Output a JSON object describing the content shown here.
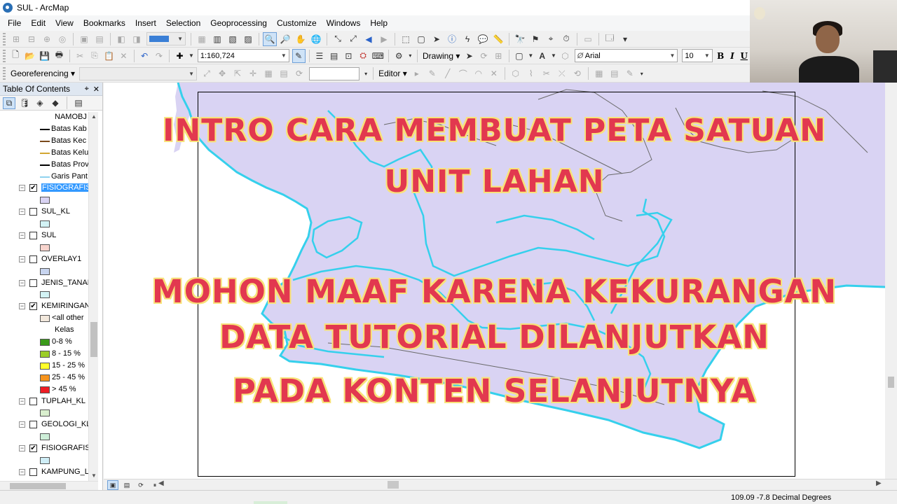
{
  "window": {
    "title": "SUL - ArcMap"
  },
  "menu": [
    "File",
    "Edit",
    "View",
    "Bookmarks",
    "Insert",
    "Selection",
    "Geoprocessing",
    "Customize",
    "Windows",
    "Help"
  ],
  "toolbar": {
    "map_scale": "1:160,724",
    "drawing_label": "Drawing",
    "font_name": "Arial",
    "font_size": "10",
    "bold_label": "B",
    "italic_label": "I",
    "underline_label": "U",
    "georeferencing_label": "Georeferencing",
    "editor_label": "Editor"
  },
  "toc": {
    "title": "Table Of Contents",
    "pin": "⌖",
    "close": "✕",
    "items": [
      {
        "type": "label",
        "label": "NAMOBJ",
        "indent": 78
      },
      {
        "type": "line",
        "label": "Batas Kab",
        "color": "#000000"
      },
      {
        "type": "line",
        "label": "Batas Kec",
        "color": "#7a4a1c"
      },
      {
        "type": "line",
        "label": "Batas Kelu",
        "color": "#d2a733"
      },
      {
        "type": "line",
        "label": "Batas Prov",
        "color": "#000000"
      },
      {
        "type": "line",
        "label": "Garis Pant",
        "color": "#8fd2ef"
      },
      {
        "type": "layer",
        "label": "FISIOGRAFIS",
        "checked": true,
        "selected": true
      },
      {
        "type": "swatch",
        "color": "#d9d3f3"
      },
      {
        "type": "layer",
        "label": "SUL_KL",
        "checked": false
      },
      {
        "type": "swatch",
        "color": "#d3f3f5"
      },
      {
        "type": "layer",
        "label": "SUL",
        "checked": false
      },
      {
        "type": "swatch",
        "color": "#f8d4cd"
      },
      {
        "type": "layer",
        "label": "OVERLAY1",
        "checked": false
      },
      {
        "type": "swatch",
        "color": "#c7d4ef"
      },
      {
        "type": "layer",
        "label": "JENIS_TANAH",
        "checked": false
      },
      {
        "type": "swatch",
        "color": "#d3f3f5"
      },
      {
        "type": "layer",
        "label": "KEMIRINGAN",
        "checked": true
      },
      {
        "type": "swatchlabel",
        "label": "<all other",
        "color": "#f2e8dc"
      },
      {
        "type": "label",
        "label": "Kelas",
        "indent": 78
      },
      {
        "type": "swatchlabel",
        "label": "0-8 %",
        "color": "#3a9a1a"
      },
      {
        "type": "swatchlabel",
        "label": "8 - 15 %",
        "color": "#9ccd28"
      },
      {
        "type": "swatchlabel",
        "label": "15 - 25 %",
        "color": "#ffff2a"
      },
      {
        "type": "swatchlabel",
        "label": "25 - 45 %",
        "color": "#f7941d"
      },
      {
        "type": "swatchlabel",
        "label": "> 45 %",
        "color": "#ee1c24"
      },
      {
        "type": "layer",
        "label": "TUPLAH_KL",
        "checked": false
      },
      {
        "type": "swatch",
        "color": "#d9efce"
      },
      {
        "type": "layer",
        "label": "GEOLOGI_KL",
        "checked": false
      },
      {
        "type": "swatch",
        "color": "#cdeed8"
      },
      {
        "type": "layer",
        "label": "FISIOGRAFIS_",
        "checked": true
      },
      {
        "type": "swatch",
        "color": "#cfeef7"
      },
      {
        "type": "layer",
        "label": "KAMPUNG_L",
        "checked": false
      }
    ]
  },
  "overlay": {
    "title_line1": "INTRO CARA MEMBUAT PETA SATUAN",
    "title_line2": "UNIT LAHAN",
    "message_line1": "MOHON MAAF KARENA KEKURANGAN",
    "message_line2": "DATA TUTORIAL DILANJUTKAN",
    "message_line3": "PADA KONTEN SELANJUTNYA"
  },
  "status": {
    "coordinates": "109.09  -7.8 Decimal Degrees"
  },
  "colors": {
    "land_fill": "#d9d3f3",
    "coastline": "#35d0ec",
    "boundary": "#6a6a6a",
    "overlay_text": "#e2384f",
    "overlay_outline": "#f8e27a"
  }
}
